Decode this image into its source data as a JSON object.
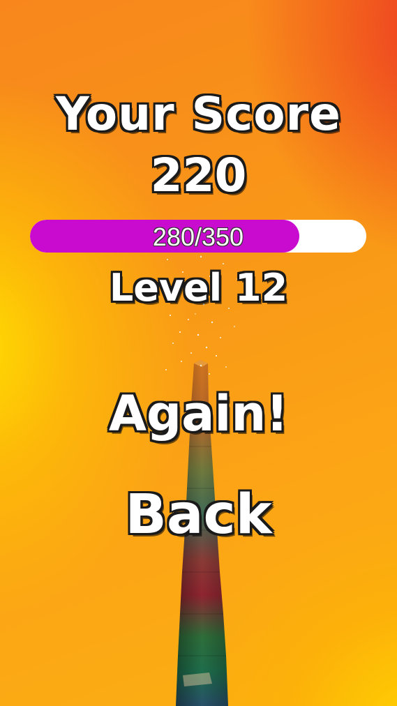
{
  "title": "Your Score",
  "score": "220",
  "progress": {
    "label": "280/350",
    "current": 280,
    "max": 350,
    "fill_color": "#c90acf",
    "track_color": "#ffffff"
  },
  "level": "Level 12",
  "buttons": {
    "again_label": "Again!",
    "back_label": "Back"
  },
  "colors": {
    "text": "#ffffff",
    "outline": "#1a1a1a",
    "background_main": "#f99a17",
    "background_hot": "#ec3424",
    "background_warm": "#ffe100"
  }
}
